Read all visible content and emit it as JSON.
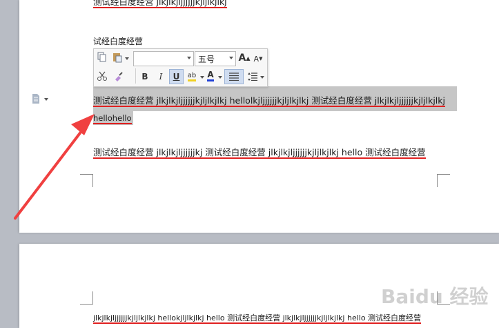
{
  "document": {
    "top_partial_text": "测试经白度经营 jlkjlkjljjjjjjkjljlkjlkj",
    "heading": "试经白度经营",
    "selected_line1": "测试经白度经营 jlkjlkjljjjjjjkjljlkjlkj     hellolkjljjjjjjkjljlkjlkj  测试经白度经营 jlkjlkjljjjjjjkjljlkjlkj",
    "selected_line2": "hellohello",
    "para2": "测试经白度经营 jlkjlkjljjjjjjkj 测试经白度经营 jlkjlkjljjjjjjkjljlkjlkj     hello 测试经白度经营",
    "page2_line": "jlkjlkjljjjjjjkjljlkjlkj     hellokjljlkjlkj    hello 测试经白度经营 jlkjlkjljjjjjjkjljlkjlkj     hello 测试经白度经营"
  },
  "toolbar": {
    "font_name": "",
    "font_size": "五号",
    "bold": "B",
    "italic": "I",
    "underline": "U",
    "font_color_letter": "A",
    "grow_font": "A",
    "shrink_font": "A",
    "highlight_letter": "ab",
    "colors": {
      "font_color": "#1f3fd6",
      "highlight": "#f0d020"
    }
  },
  "watermark": {
    "text": "Baidu 经验"
  },
  "colors": {
    "spell_underline": "#e02020",
    "selection": "#c6c6c6",
    "arrow": "#f04040"
  }
}
